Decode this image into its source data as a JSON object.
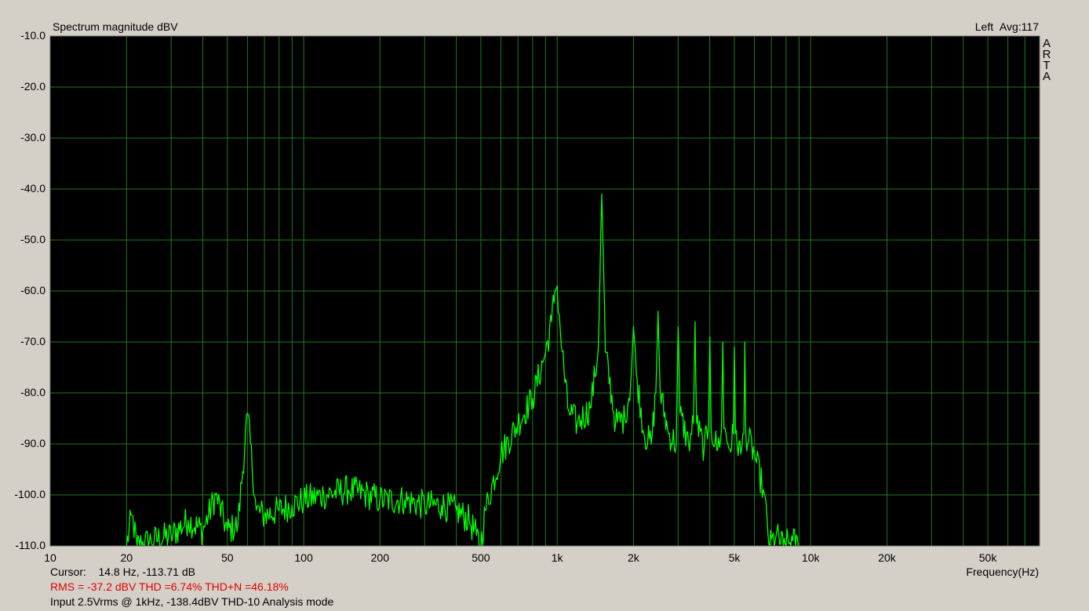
{
  "header": {
    "title": "Spectrum magnitude dBV",
    "channel": "Left",
    "avg": "Avg:117"
  },
  "logo": [
    "A",
    "R",
    "T",
    "A"
  ],
  "footer": {
    "cursor_label": "Cursor:",
    "cursor_value": "14.8 Hz, -113.71 dB",
    "stats": "RMS =  -37.2 dBV   THD =6.74%   THD+N =46.18%",
    "note": "Input 2.5Vrms @ 1kHz, -138.4dBV THD-10 Analysis mode"
  },
  "colors": {
    "background": "#d4d0c8",
    "plot_bg": "#000000",
    "grid": "#1f7a1f",
    "trace": "#00ff00",
    "stats_text": "#e00000"
  },
  "chart_data": {
    "type": "line",
    "title": "Spectrum magnitude dBV",
    "xlabel": "Frequency(Hz)",
    "ylabel": "",
    "xscale": "log",
    "xlim": [
      10,
      80000
    ],
    "ylim": [
      -110,
      -10
    ],
    "grid": true,
    "y_ticks": [
      -10,
      -20,
      -30,
      -40,
      -50,
      -60,
      -70,
      -80,
      -90,
      -100,
      -110
    ],
    "y_tick_labels": [
      "-10.0",
      "-20.0",
      "-30.0",
      "-40.0",
      "-50.0",
      "-60.0",
      "-70.0",
      "-80.0",
      "-90.0",
      "-100.0",
      "-110.0"
    ],
    "x_ticks": [
      10,
      20,
      50,
      100,
      200,
      500,
      1000,
      2000,
      5000,
      10000,
      20000,
      50000
    ],
    "x_tick_labels": [
      "10",
      "20",
      "50",
      "100",
      "200",
      "500",
      "1k",
      "2k",
      "5k",
      "10k",
      "20k",
      "50k"
    ],
    "series": [
      {
        "x": [
          20,
          21,
          22,
          25,
          30,
          35,
          40,
          45,
          50,
          55,
          60,
          65,
          70,
          80,
          90,
          100,
          120,
          150,
          180,
          200,
          250,
          300,
          350,
          400,
          450,
          480,
          500,
          520,
          600,
          700,
          800,
          900,
          950,
          980,
          1000,
          1030,
          1100,
          1200,
          1350,
          1450,
          1500,
          1550,
          1700,
          1850,
          1950,
          2000,
          2050,
          2200,
          2350,
          2450,
          2500,
          2550,
          2750,
          2950,
          3000,
          3050,
          3300,
          3450,
          3500,
          3550,
          3800,
          3950,
          4000,
          4050,
          4300,
          4450,
          4500,
          4550,
          4800,
          4950,
          5000,
          5050,
          5300,
          5450,
          5500,
          5550,
          6000,
          6500,
          6900,
          7300,
          7800,
          8500,
          9000
        ],
        "y": [
          -110,
          -104,
          -110,
          -109,
          -108,
          -105,
          -107,
          -100,
          -107,
          -106,
          -84,
          -103,
          -104,
          -103,
          -102,
          -101,
          -100,
          -99,
          -100,
          -101,
          -101,
          -102,
          -102,
          -103,
          -105,
          -108,
          -110,
          -103,
          -92,
          -86,
          -81,
          -72,
          -66,
          -60,
          -59,
          -68,
          -83,
          -86,
          -83,
          -72,
          -41,
          -72,
          -86,
          -85,
          -78,
          -67,
          -76,
          -88,
          -90,
          -80,
          -64,
          -80,
          -88,
          -90,
          -67,
          -84,
          -90,
          -86,
          -66,
          -86,
          -91,
          -87,
          -69,
          -87,
          -91,
          -87,
          -70,
          -87,
          -91,
          -88,
          -71,
          -88,
          -92,
          -88,
          -70,
          -88,
          -92,
          -99,
          -110,
          -108,
          -110,
          -109,
          -110
        ]
      }
    ]
  }
}
